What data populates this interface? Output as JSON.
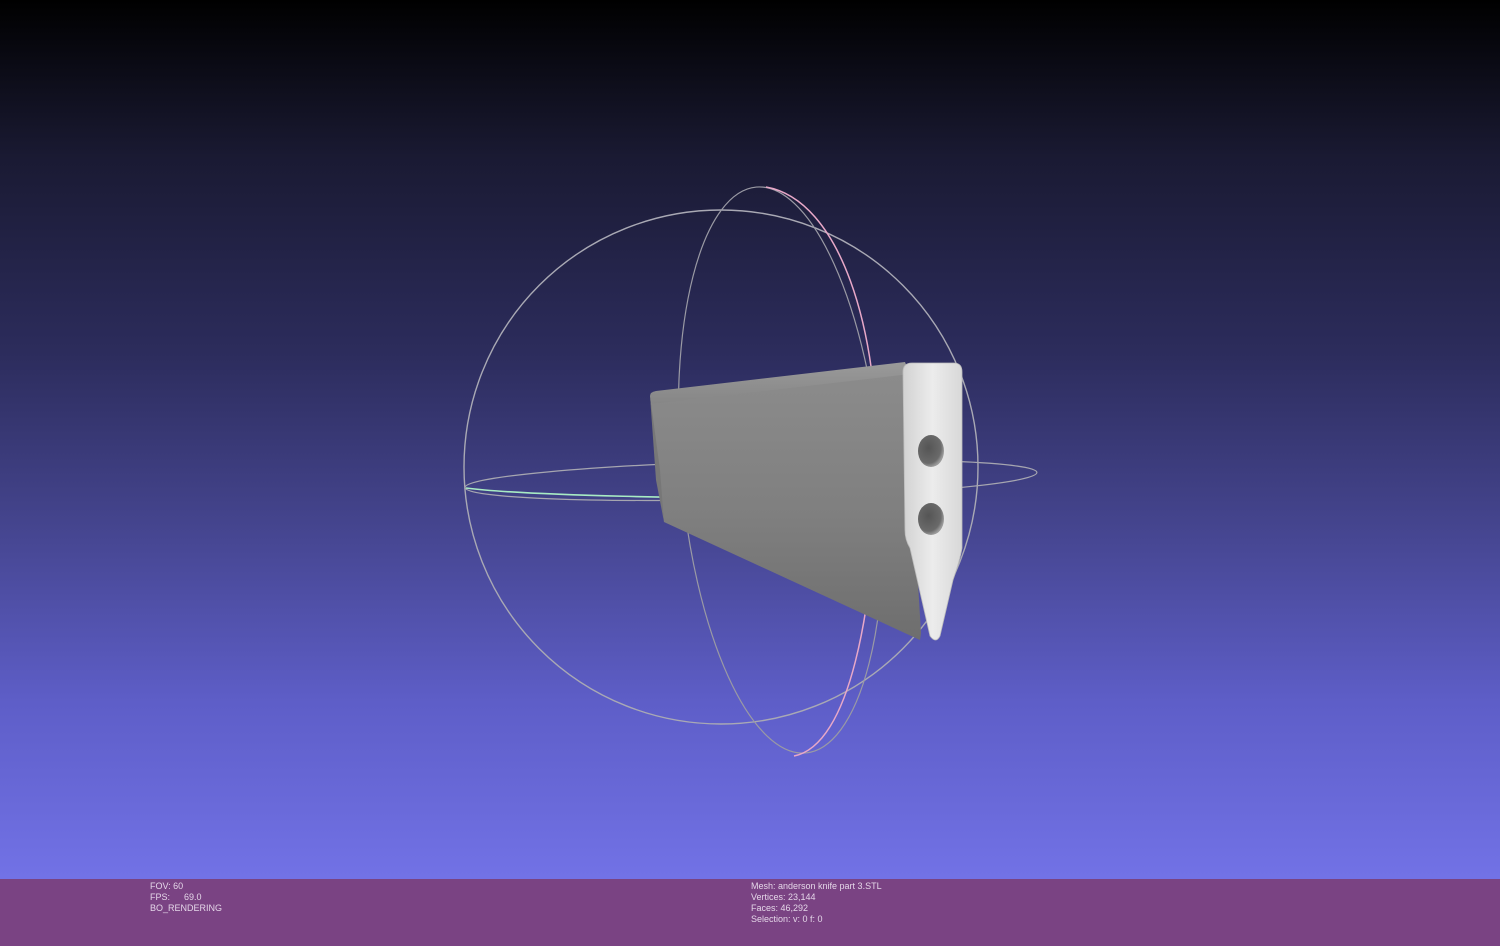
{
  "viewport": {
    "background_top": "#000000",
    "background_bottom": "#7272e6",
    "trackball_colors": {
      "horizontal_ring": "#a6e8c0",
      "vertical_ring": "#e6a6c6",
      "outer_ring": "#b0b0b8"
    },
    "mesh_color": "#8a8a8a",
    "mesh_end_face_color": "#e0e0e0"
  },
  "statusbar": {
    "background": "#7a4383",
    "left": {
      "fov": "FOV: 60",
      "fps_label": "FPS:",
      "fps_value": "69.0",
      "render_mode": "BO_RENDERING"
    },
    "right": {
      "mesh": "Mesh: anderson knife part 3.STL",
      "vertices": "Vertices: 23,144",
      "faces": "Faces: 46,292",
      "selection": "Selection: v: 0 f: 0"
    }
  }
}
